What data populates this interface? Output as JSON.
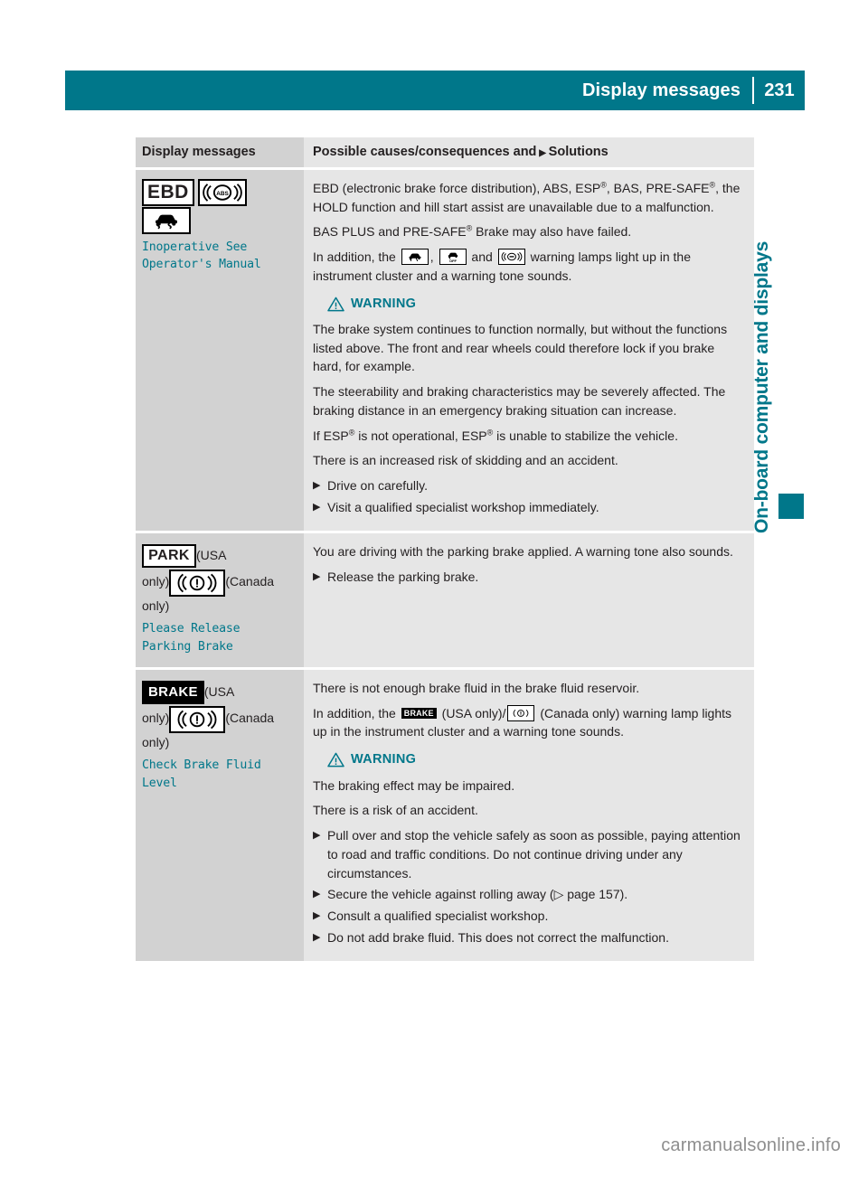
{
  "header": {
    "title": "Display messages",
    "page_number": "231"
  },
  "side_tab": {
    "label": "On-board computer and displays"
  },
  "table": {
    "headers": {
      "left": "Display messages",
      "right_before": "Possible causes/consequences and",
      "right_after": "Solutions"
    },
    "rows": [
      {
        "symbols": {
          "ebd_label": "EBD",
          "abs_icon": "abs-icon",
          "esp_icon": "esp-skid-icon"
        },
        "message": "Inoperative See\nOperator's Manual",
        "paragraphs": {
          "p1_a": "EBD (electronic brake force distribution), ABS, ESP",
          "p1_sup1": "®",
          "p1_b": ", BAS, PRE-SAFE",
          "p1_sup2": "®",
          "p1_c": ", the HOLD function and hill start assist are unavailable due to a malfunction.",
          "p2_a": "BAS PLUS and PRE-SAFE",
          "p2_sup": "®",
          "p2_b": " Brake may also have failed.",
          "p3_a": "In addition, the",
          "p3_b": ",",
          "p3_c": "and",
          "p3_d": "warning lamps light up in the instrument cluster and a warning tone sounds."
        },
        "warning": {
          "label": "WARNING",
          "texts": [
            "The brake system continues to function normally, but without the functions listed above. The front and rear wheels could therefore lock if you brake hard, for example.",
            "The steerability and braking characteristics may be severely affected. The braking distance in an emergency braking situation can increase."
          ],
          "esp_line_a": "If ESP",
          "esp_line_sup1": "®",
          "esp_line_b": " is not operational, ESP",
          "esp_line_sup2": "®",
          "esp_line_c": " is unable to stabilize the vehicle.",
          "risk_text": "There is an increased risk of skidding and an accident.",
          "solutions": [
            "Drive on carefully.",
            "Visit a qualified specialist workshop immediately."
          ]
        }
      },
      {
        "symbols": {
          "park_label": "PARK",
          "usa_note": "(USA",
          "only_note": "only)",
          "brake_circle_icon": "brake-warning-icon",
          "canada_note": "(Canada",
          "only_note2": "only)"
        },
        "message": "Please Release\nParking Brake",
        "paragraphs": {
          "p1": "You are driving with the parking brake applied. A warning tone also sounds."
        },
        "solutions": [
          "Release the parking brake."
        ]
      },
      {
        "symbols": {
          "brake_label": "BRAKE",
          "usa_note": "(USA",
          "only_note": "only)",
          "brake_circle_icon": "brake-warning-icon",
          "canada_note": "(Canada",
          "only_note2": "only)"
        },
        "message": "Check Brake Fluid\nLevel",
        "paragraphs": {
          "p1": "There is not enough brake fluid in the brake fluid reservoir.",
          "p2_a": "In addition, the",
          "p2_brake": "BRAKE",
          "p2_b": "(USA only)/",
          "p2_c": "(Canada only) warning lamp lights up in the instrument cluster and a warning tone sounds."
        },
        "warning": {
          "label": "WARNING",
          "texts": [
            "The braking effect may be impaired.",
            "There is a risk of an accident."
          ],
          "solutions": [
            "Pull over and stop the vehicle safely as soon as possible, paying attention to road and traffic conditions. Do not continue driving under any circumstances.",
            "Consult a qualified specialist workshop.",
            "Do not add brake fluid. This does not correct the malfunction."
          ],
          "secure_a": "Secure the vehicle against rolling away (",
          "secure_ref": "▷ page 157",
          "secure_b": ")."
        }
      }
    ]
  },
  "footer": {
    "watermark": "carmanualsonline.info"
  },
  "colors": {
    "accent_teal": "#00778a",
    "left_cell_gray": "#d2d2d2",
    "right_cell_gray": "#e6e6e6"
  }
}
